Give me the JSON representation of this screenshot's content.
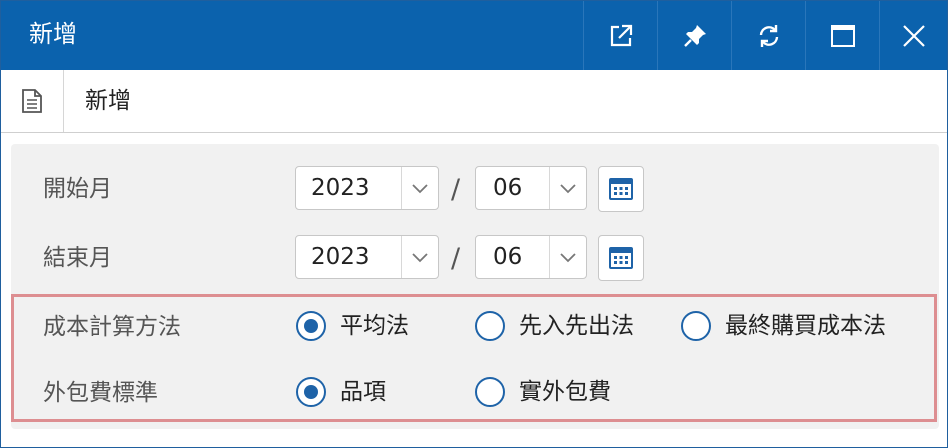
{
  "window": {
    "title": "新增"
  },
  "titlebar_buttons": [
    "popout-icon",
    "pin-icon",
    "refresh-icon",
    "maximize-icon",
    "close-icon"
  ],
  "doc_bar": {
    "icon": "document-icon",
    "title": "新增"
  },
  "form": {
    "start_month": {
      "label": "開始月",
      "year": "2023",
      "separator": "/",
      "month": "06"
    },
    "end_month": {
      "label": "結束月",
      "year": "2023",
      "separator": "/",
      "month": "06"
    },
    "cost_method": {
      "label": "成本計算方法",
      "options": [
        "平均法",
        "先入先出法",
        "最終購買成本法"
      ],
      "selected": "平均法"
    },
    "outsource_standard": {
      "label": "外包費標準",
      "options": [
        "品項",
        "實外包費"
      ],
      "selected": "品項"
    }
  },
  "colors": {
    "titlebar": "#0b62ad",
    "accent": "#1e63a8",
    "highlight_border": "#dd8e91",
    "panel_bg": "#f1f1f1"
  }
}
